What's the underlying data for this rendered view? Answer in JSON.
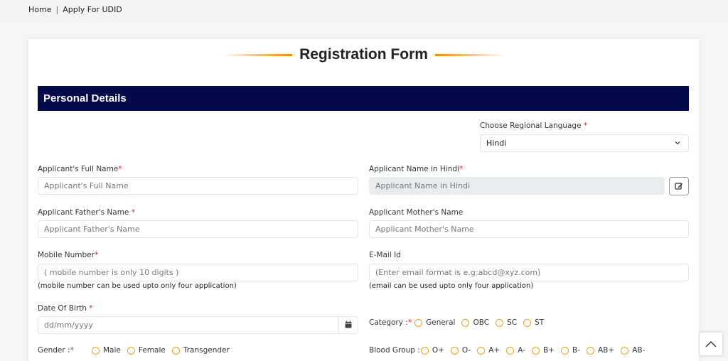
{
  "breadcrumb": {
    "home": "Home",
    "separator": "|",
    "current": "Apply For UDID"
  },
  "form": {
    "title": "Registration Form",
    "section": "Personal Details",
    "regional_language": {
      "label": "Choose Regional Language",
      "required": "*",
      "value": "Hindi"
    },
    "full_name": {
      "label": "Applicant's Full Name",
      "required": "*",
      "placeholder": "Applicant's Full Name"
    },
    "hindi_name": {
      "label": "Applicant Name in Hindi",
      "required": "*",
      "placeholder": "Applicant Name in Hindi"
    },
    "father_name": {
      "label": "Applicant Father's Name",
      "required": "*",
      "placeholder": "Applicant Father's Name"
    },
    "mother_name": {
      "label": "Applicant Mother's Name",
      "placeholder": "Applicant Mother's Name"
    },
    "mobile": {
      "label": "Mobile Number",
      "required": "*",
      "placeholder": "( mobile number is only 10 digits )",
      "help": "(mobile number can be used upto only four application)"
    },
    "email": {
      "label": "E-Mail Id",
      "placeholder": "(Enter email format is e.g:abcd@xyz.com)",
      "help": "(email can be used upto only four application)"
    },
    "dob": {
      "label": "Date Of Birth",
      "required": "*",
      "placeholder": "dd/mm/yyyy"
    },
    "category": {
      "label": "Category :",
      "required": "*",
      "options": [
        "General",
        "OBC",
        "SC",
        "ST"
      ]
    },
    "gender": {
      "label": "Gender :",
      "required": "*",
      "options": [
        "Male",
        "Female",
        "Transgender"
      ]
    },
    "blood_group": {
      "label": "Blood Group :",
      "options": [
        "O+",
        "O-",
        "A+",
        "A-",
        "B+",
        "B-",
        "AB+",
        "AB-"
      ]
    }
  },
  "colors": {
    "header_bg": "#020a4a",
    "accent": "#f5870a",
    "required": "#e11111"
  }
}
